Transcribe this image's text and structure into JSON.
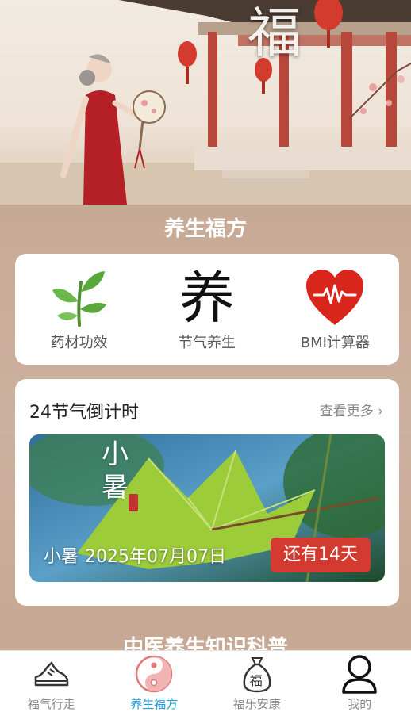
{
  "hero": {
    "banner_char": "福",
    "image": "elderly-woman-qipao-fan-courtyard"
  },
  "sections": {
    "health_title": "养生福方",
    "knowledge_title": "中医养生知识科普"
  },
  "tools": [
    {
      "label": "药材功效",
      "icon": "herb-leaf-icon"
    },
    {
      "label": "节气养生",
      "icon": "yang-character-icon",
      "glyph": "养"
    },
    {
      "label": "BMI计算器",
      "icon": "heart-pulse-icon"
    }
  ],
  "solar_terms": {
    "title": "24节气倒计时",
    "more_label": "查看更多",
    "more_icon": "chevron-right-icon",
    "term_art": "小暑",
    "term_name": "小暑",
    "term_date": "2025年07月07日",
    "countdown": "还有14天"
  },
  "tabbar": [
    {
      "label": "福气行走",
      "icon": "sneaker-icon",
      "active": false
    },
    {
      "label": "养生福方",
      "icon": "yin-yang-icon",
      "active": true
    },
    {
      "label": "福乐安康",
      "icon": "fortune-bag-icon",
      "glyph": "福",
      "active": false
    },
    {
      "label": "我的",
      "icon": "user-icon",
      "active": false
    }
  ],
  "colors": {
    "page_bg": "#c9ad98",
    "accent_blue": "#1e9ee0",
    "countdown_red": "#d43b30",
    "heart_red": "#d8261d",
    "leaf_green": "#5aa83b"
  }
}
